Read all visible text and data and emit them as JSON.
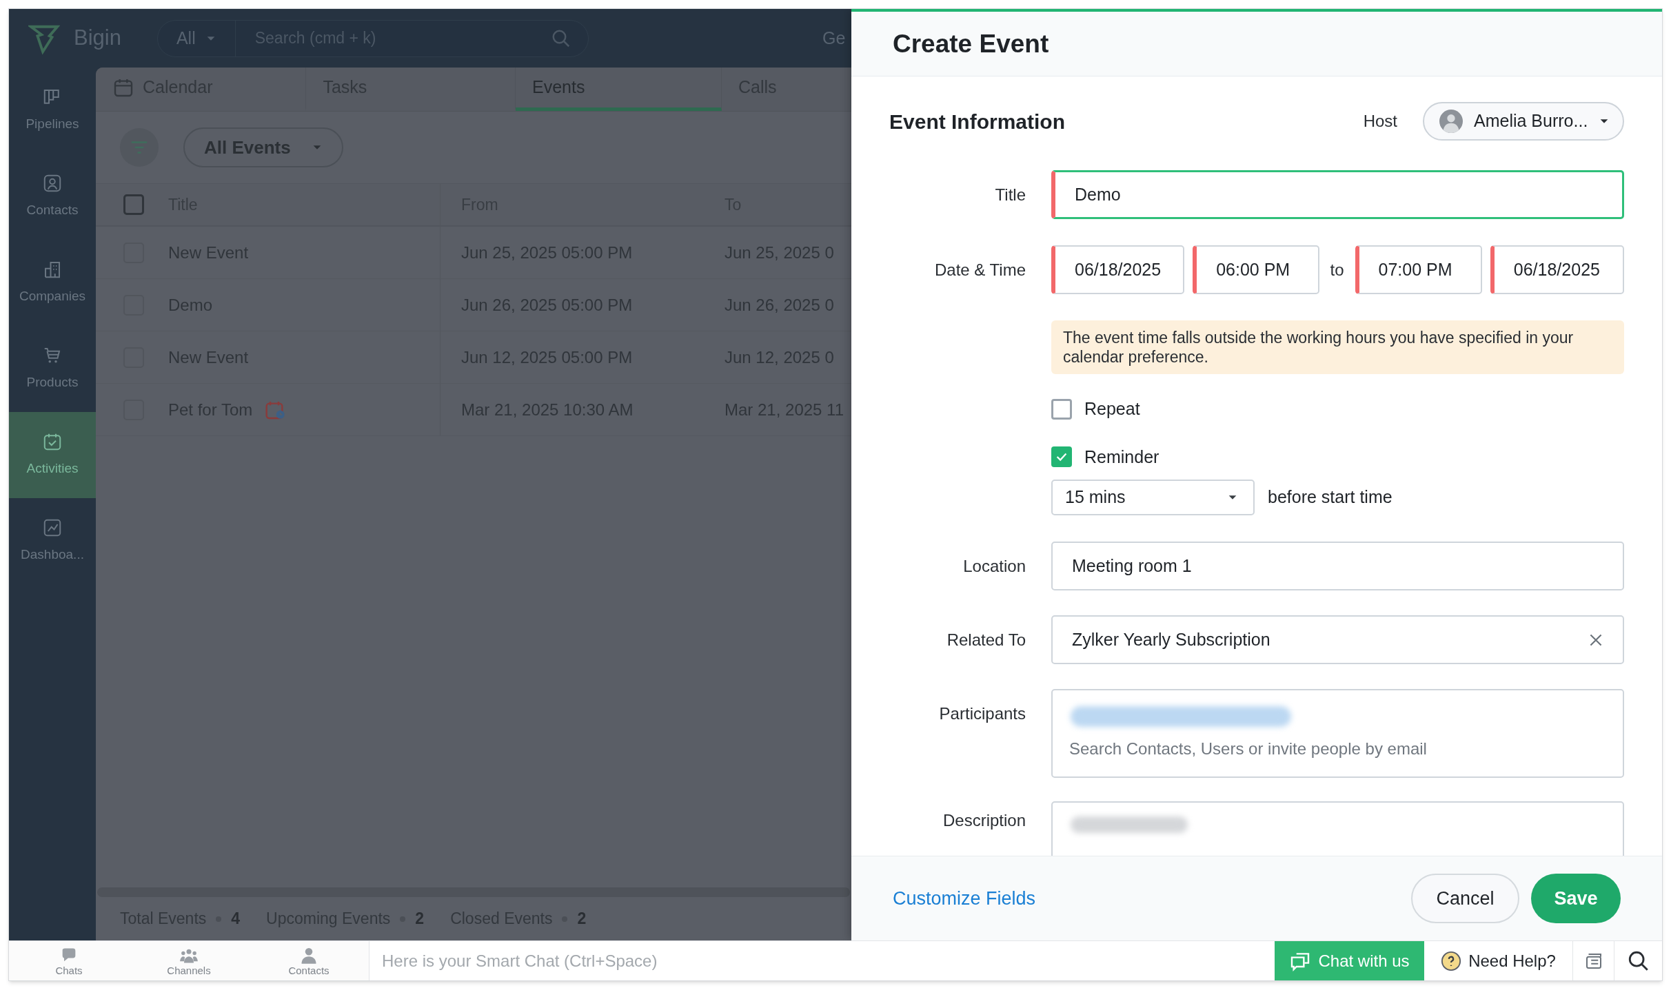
{
  "app": {
    "name": "Bigin",
    "scope": "All",
    "search_placeholder": "Search (cmd + k)",
    "cut_text": "Ge"
  },
  "sidebar": {
    "items": [
      {
        "label": "Pipelines",
        "selected": false
      },
      {
        "label": "Contacts",
        "selected": false
      },
      {
        "label": "Companies",
        "selected": false
      },
      {
        "label": "Products",
        "selected": false
      },
      {
        "label": "Activities",
        "selected": true
      },
      {
        "label": "Dashboa...",
        "selected": false
      }
    ]
  },
  "tabs": [
    {
      "label": "Calendar",
      "selected": false
    },
    {
      "label": "Tasks",
      "selected": false
    },
    {
      "label": "Events",
      "selected": true
    },
    {
      "label": "Calls",
      "selected": false
    }
  ],
  "view": {
    "label": "All Events"
  },
  "table": {
    "select_all_checked": false,
    "columns": [
      "Title",
      "From",
      "To"
    ],
    "rows": [
      {
        "checked": false,
        "title": "New Event",
        "from": "Jun 25, 2025 05:00 PM",
        "to": "Jun 25, 2025 0",
        "recurring_icon": false
      },
      {
        "checked": false,
        "title": "Demo",
        "from": "Jun 26, 2025 05:00 PM",
        "to": "Jun 26, 2025 0",
        "recurring_icon": false
      },
      {
        "checked": false,
        "title": "New Event",
        "from": "Jun 12, 2025 05:00 PM",
        "to": "Jun 12, 2025 0",
        "recurring_icon": false
      },
      {
        "checked": false,
        "title": "Pet for Tom",
        "from": "Mar 21, 2025 10:30 AM",
        "to": "Mar 21, 2025 11",
        "recurring_icon": true
      }
    ]
  },
  "summary": [
    {
      "label": "Total Events",
      "count": "4"
    },
    {
      "label": "Upcoming Events",
      "count": "2"
    },
    {
      "label": "Closed Events",
      "count": "2"
    }
  ],
  "dialog": {
    "title": "Create Event",
    "section": "Event Information",
    "host": {
      "label": "Host",
      "name": "Amelia Burro..."
    },
    "fields": [
      {
        "kind": "text",
        "label": "Title",
        "value": "Demo",
        "required": true,
        "focused": true
      },
      {
        "kind": "datetime",
        "label": "Date & Time",
        "start_date": "06/18/2025",
        "start_time": "06:00 PM",
        "joiner": "to",
        "end_time": "07:00 PM",
        "end_date": "06/18/2025",
        "required": true
      },
      {
        "kind": "notice",
        "text": "The event time falls outside the working hours you have specified in your calendar preference."
      },
      {
        "kind": "checkbox",
        "label": "Repeat",
        "checked": false
      },
      {
        "kind": "checkbox",
        "label": "Reminder",
        "checked": true
      },
      {
        "kind": "select",
        "value": "15 mins",
        "suffix": "before start time"
      },
      {
        "kind": "text",
        "label": "Location",
        "value": "Meeting room 1",
        "required": false,
        "focused": false
      },
      {
        "kind": "clearable",
        "label": "Related To",
        "value": "Zylker Yearly Subscription"
      },
      {
        "kind": "participants",
        "label": "Participants",
        "placeholder": "Search Contacts, Users or invite people by email"
      },
      {
        "kind": "textarea",
        "label": "Description"
      }
    ],
    "footer": {
      "link": "Customize Fields",
      "cancel": "Cancel",
      "save": "Save"
    }
  },
  "bottom_bar": {
    "items": [
      {
        "label": "Chats"
      },
      {
        "label": "Channels"
      },
      {
        "label": "Contacts"
      }
    ],
    "smart_chat_placeholder": "Here is your Smart Chat (Ctrl+Space)",
    "chat_button": "Chat with us",
    "help": "Need Help?"
  }
}
